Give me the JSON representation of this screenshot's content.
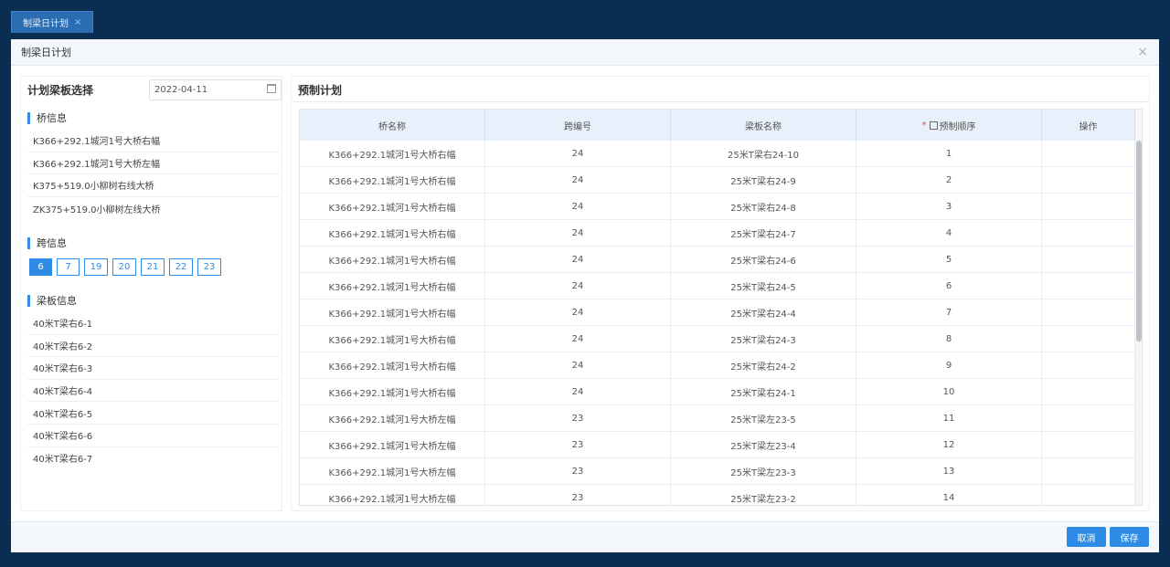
{
  "tab": {
    "label": "制梁日计划",
    "close": "×"
  },
  "dialog": {
    "title": "制梁日计划",
    "close": "×"
  },
  "left": {
    "title": "计划梁板选择",
    "date": "2022-04-11",
    "bridge_section": "桥信息",
    "bridges": [
      "K366+292.1城河1号大桥右幅",
      "K366+292.1城河1号大桥左幅",
      "K375+519.0小柳树右线大桥",
      "ZK375+519.0小柳树左线大桥"
    ],
    "span_section": "跨信息",
    "spans": [
      "6",
      "7",
      "19",
      "20",
      "21",
      "22",
      "23"
    ],
    "beam_section": "梁板信息",
    "beams": [
      "40米T梁右6-1",
      "40米T梁右6-2",
      "40米T梁右6-3",
      "40米T梁右6-4",
      "40米T梁右6-5",
      "40米T梁右6-6",
      "40米T梁右6-7"
    ]
  },
  "right": {
    "title": "预制计划",
    "columns": [
      "桥名称",
      "跨编号",
      "梁板名称",
      "预制顺序",
      "操作"
    ],
    "required_mark": "*",
    "rows": [
      [
        "K366+292.1城河1号大桥右幅",
        "24",
        "25米T梁右24-10",
        "1",
        ""
      ],
      [
        "K366+292.1城河1号大桥右幅",
        "24",
        "25米T梁右24-9",
        "2",
        ""
      ],
      [
        "K366+292.1城河1号大桥右幅",
        "24",
        "25米T梁右24-8",
        "3",
        ""
      ],
      [
        "K366+292.1城河1号大桥右幅",
        "24",
        "25米T梁右24-7",
        "4",
        ""
      ],
      [
        "K366+292.1城河1号大桥右幅",
        "24",
        "25米T梁右24-6",
        "5",
        ""
      ],
      [
        "K366+292.1城河1号大桥右幅",
        "24",
        "25米T梁右24-5",
        "6",
        ""
      ],
      [
        "K366+292.1城河1号大桥右幅",
        "24",
        "25米T梁右24-4",
        "7",
        ""
      ],
      [
        "K366+292.1城河1号大桥右幅",
        "24",
        "25米T梁右24-3",
        "8",
        ""
      ],
      [
        "K366+292.1城河1号大桥右幅",
        "24",
        "25米T梁右24-2",
        "9",
        ""
      ],
      [
        "K366+292.1城河1号大桥右幅",
        "24",
        "25米T梁右24-1",
        "10",
        ""
      ],
      [
        "K366+292.1城河1号大桥左幅",
        "23",
        "25米T梁左23-5",
        "11",
        ""
      ],
      [
        "K366+292.1城河1号大桥左幅",
        "23",
        "25米T梁左23-4",
        "12",
        ""
      ],
      [
        "K366+292.1城河1号大桥左幅",
        "23",
        "25米T梁左23-3",
        "13",
        ""
      ],
      [
        "K366+292.1城河1号大桥左幅",
        "23",
        "25米T梁左23-2",
        "14",
        ""
      ]
    ]
  },
  "footer": {
    "cancel": "取消",
    "save": "保存"
  },
  "colors": {
    "accent": "#2e8be6",
    "background": "#0b2d52",
    "required": "#e04b4b"
  }
}
